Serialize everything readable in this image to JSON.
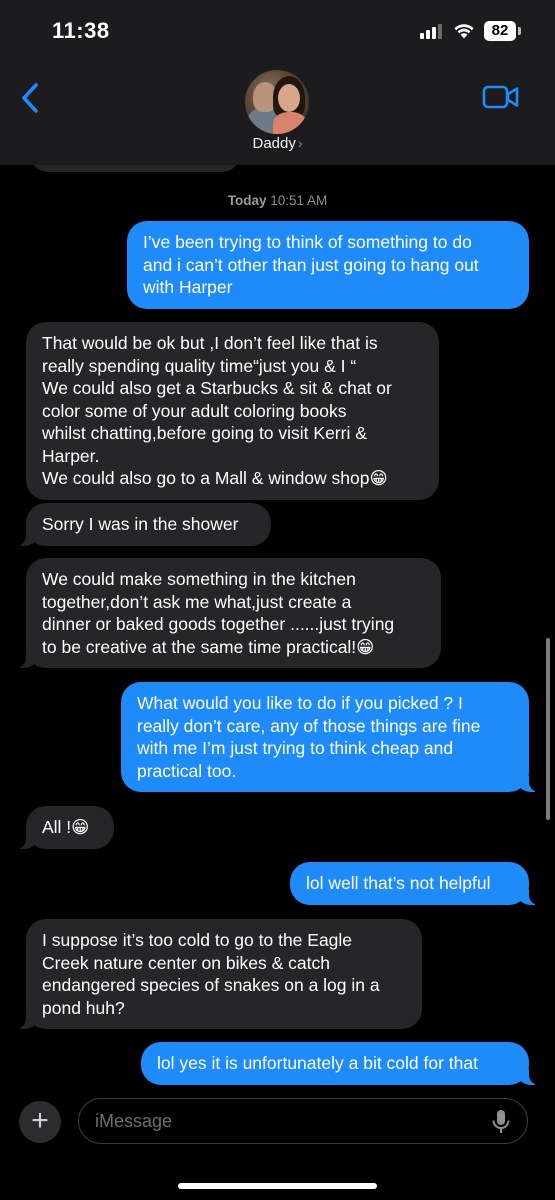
{
  "status_bar": {
    "time": "11:38",
    "battery": "82"
  },
  "header": {
    "contact_name": "Daddy",
    "chevron": "›",
    "icons": [
      "chevron-left-icon",
      "video-camera-icon"
    ],
    "accent_color": "#1f8bf8"
  },
  "conversation": {
    "timestamp_day": "Today",
    "timestamp_time": "10:51 AM",
    "messages": [
      {
        "direction": "outgoing",
        "text": "I’ve been trying to think of something to do\nand i can’t other than just going to hang out\nwith Harper"
      },
      {
        "direction": "incoming",
        "text": "That would be ok but ,I don’t feel like that is\nreally spending quality time“just you & I “\nWe could also get a Starbucks & sit & chat or\ncolor some of your adult coloring books\nwhilst chatting,before going to visit Kerri &\nHarper.\nWe could also go to a Mall & window shop😁"
      },
      {
        "direction": "incoming",
        "text": "Sorry I was in the shower"
      },
      {
        "direction": "incoming",
        "text": "We could make something in the kitchen\ntogether,don’t ask me what,just create a\ndinner or baked goods together ......just trying\nto be creative at the same time practical!😁"
      },
      {
        "direction": "outgoing",
        "text": "What would you like to do if you picked ? I\nreally don’t care, any of those things are fine\nwith me I’m just trying to think cheap and\npractical too."
      },
      {
        "direction": "incoming",
        "text": "All !😁"
      },
      {
        "direction": "outgoing",
        "text": "lol well that’s not helpful"
      },
      {
        "direction": "incoming",
        "text": "I suppose it’s too cold to go to the Eagle\nCreek nature center on bikes & catch\nendangered species of snakes on a log in a\npond huh?"
      },
      {
        "direction": "outgoing",
        "text": "lol yes it is unfortunately a bit cold for that"
      }
    ]
  },
  "composer": {
    "placeholder": "iMessage",
    "plus_label": "+",
    "icons": [
      "plus-icon",
      "microphone-icon"
    ]
  },
  "colors": {
    "outgoing_bubble": "#1f8bf8",
    "incoming_bubble": "#262628",
    "background": "#000000"
  }
}
